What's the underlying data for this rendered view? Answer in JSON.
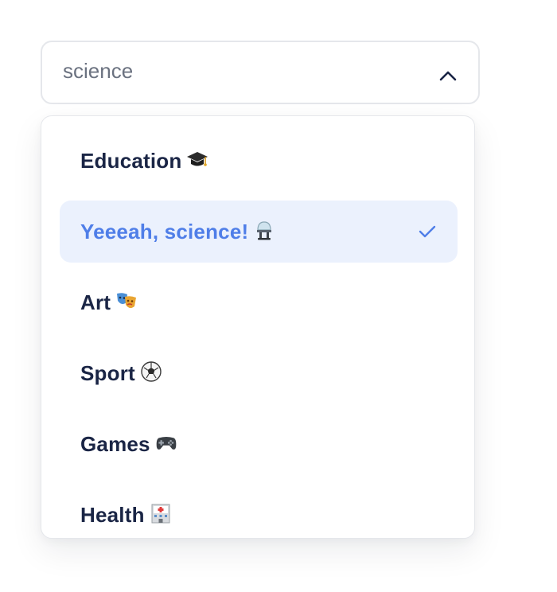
{
  "select": {
    "value": "science",
    "expanded": true
  },
  "dropdown": {
    "options": [
      {
        "label": "Education",
        "icon": "graduation-cap-icon",
        "selected": false
      },
      {
        "label": "Yeeeah, science!",
        "icon": "microscope-icon",
        "selected": true
      },
      {
        "label": "Art",
        "icon": "theater-masks-icon",
        "selected": false
      },
      {
        "label": "Sport",
        "icon": "soccer-ball-icon",
        "selected": false
      },
      {
        "label": "Games",
        "icon": "game-controller-icon",
        "selected": false
      },
      {
        "label": "Health",
        "icon": "hospital-icon",
        "selected": false
      }
    ]
  },
  "colors": {
    "text": "#1a2545",
    "accent": "#4f7ee8",
    "selected_bg": "#ebf1fd",
    "border": "#e5e7eb",
    "placeholder": "#6b7280"
  }
}
